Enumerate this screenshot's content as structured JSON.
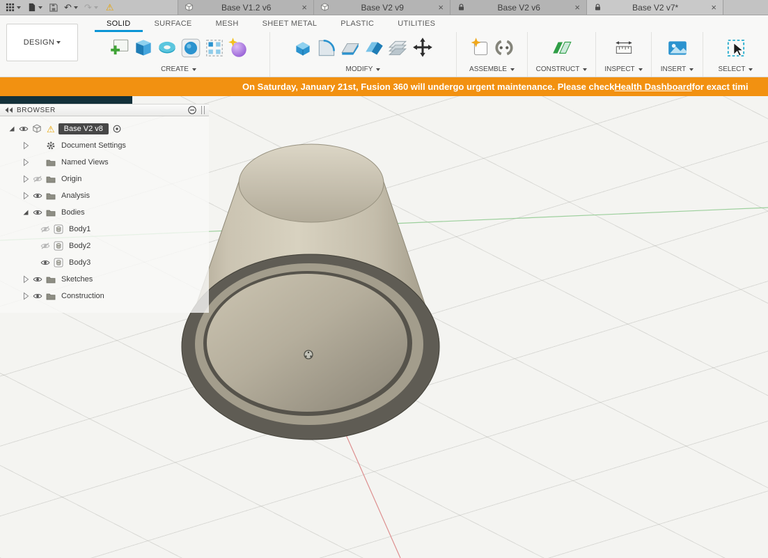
{
  "colors": {
    "accent": "#0a95d6",
    "banner": "#f29111",
    "model_tan": "#cbc4b2",
    "axis_red": "#dd8f8f",
    "axis_green": "#9ccf9c"
  },
  "icons": {
    "warning": "⚠",
    "undo": "↶",
    "redo": "↷"
  },
  "titlebar": {
    "close_glyph": "×",
    "tabs": [
      {
        "label": "Base V1.2 v6",
        "icon": "cube"
      },
      {
        "label": "Base V2 v9",
        "icon": "cube"
      },
      {
        "label": "Base V2 v6",
        "icon": "lock"
      },
      {
        "label": "Base V2 v7*",
        "icon": "lock"
      }
    ]
  },
  "toolbar": {
    "workspace_label": "DESIGN",
    "tabs": [
      {
        "label": "SOLID",
        "active": true
      },
      {
        "label": "SURFACE",
        "active": false
      },
      {
        "label": "MESH",
        "active": false
      },
      {
        "label": "SHEET METAL",
        "active": false
      },
      {
        "label": "PLASTIC",
        "active": false
      },
      {
        "label": "UTILITIES",
        "active": false
      }
    ],
    "groups": [
      {
        "label": "CREATE"
      },
      {
        "label": "MODIFY"
      },
      {
        "label": "ASSEMBLE"
      },
      {
        "label": "CONSTRUCT"
      },
      {
        "label": "INSPECT"
      },
      {
        "label": "INSERT"
      },
      {
        "label": "SELECT"
      }
    ]
  },
  "banner": {
    "prefix": "On Saturday, January 21st, Fusion 360 will undergo urgent maintenance. Please check ",
    "link": "Health Dashboard",
    "suffix": " for exact timi"
  },
  "browser": {
    "title": "BROWSER",
    "root": {
      "label": "Base V2 v8"
    },
    "items": [
      {
        "label": "Document Settings"
      },
      {
        "label": "Named Views"
      },
      {
        "label": "Origin"
      },
      {
        "label": "Analysis"
      },
      {
        "label": "Bodies"
      },
      {
        "label": "Body1"
      },
      {
        "label": "Body2"
      },
      {
        "label": "Body3"
      },
      {
        "label": "Sketches"
      },
      {
        "label": "Construction"
      }
    ]
  }
}
